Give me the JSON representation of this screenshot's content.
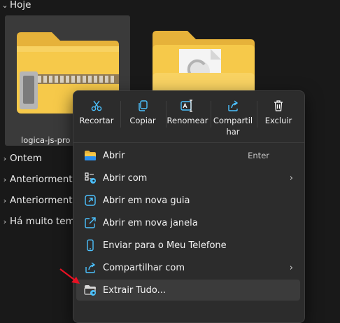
{
  "groups": {
    "today": "Hoje",
    "yesterday": "Ontem",
    "earlier1": "Anteriorment",
    "earlier2": "Anteriorment",
    "long_ago": "Há muito tem"
  },
  "files": [
    {
      "name": "logica-js-pro",
      "type": "zip-folder-icon",
      "selected": true
    },
    {
      "name": "",
      "type": "folder-with-document-icon",
      "selected": false
    }
  ],
  "context_menu": {
    "commands": [
      {
        "label": "Recortar",
        "icon": "scissors-icon"
      },
      {
        "label": "Copiar",
        "icon": "copy-icon"
      },
      {
        "label": "Renomear",
        "icon": "rename-icon"
      },
      {
        "label": "Compartilhar",
        "label_line2": "har",
        "label_line1": "Compartil",
        "icon": "share-icon"
      },
      {
        "label": "Excluir",
        "icon": "trash-icon"
      }
    ],
    "items": [
      {
        "label": "Abrir",
        "shortcut": "Enter",
        "icon": "folder-icon"
      },
      {
        "label": "Abrir com",
        "icon": "open-with-icon",
        "submenu": true
      },
      {
        "label": "Abrir em nova guia",
        "icon": "new-tab-icon"
      },
      {
        "label": "Abrir em nova janela",
        "icon": "new-window-icon"
      },
      {
        "label": "Enviar para o Meu Telefone",
        "icon": "phone-icon"
      },
      {
        "label": "Compartilhar com",
        "icon": "share-icon",
        "submenu": true
      },
      {
        "label": "Extrair Tudo...",
        "icon": "extract-icon",
        "hovered": true
      }
    ],
    "submenu_arrow": "›"
  },
  "colors": {
    "background": "#191919",
    "menu_bg": "#2c2c2c",
    "accent_blue": "#4cc2ff",
    "annotation_arrow": "#e81123",
    "folder_yellow": "#f6c94a"
  }
}
